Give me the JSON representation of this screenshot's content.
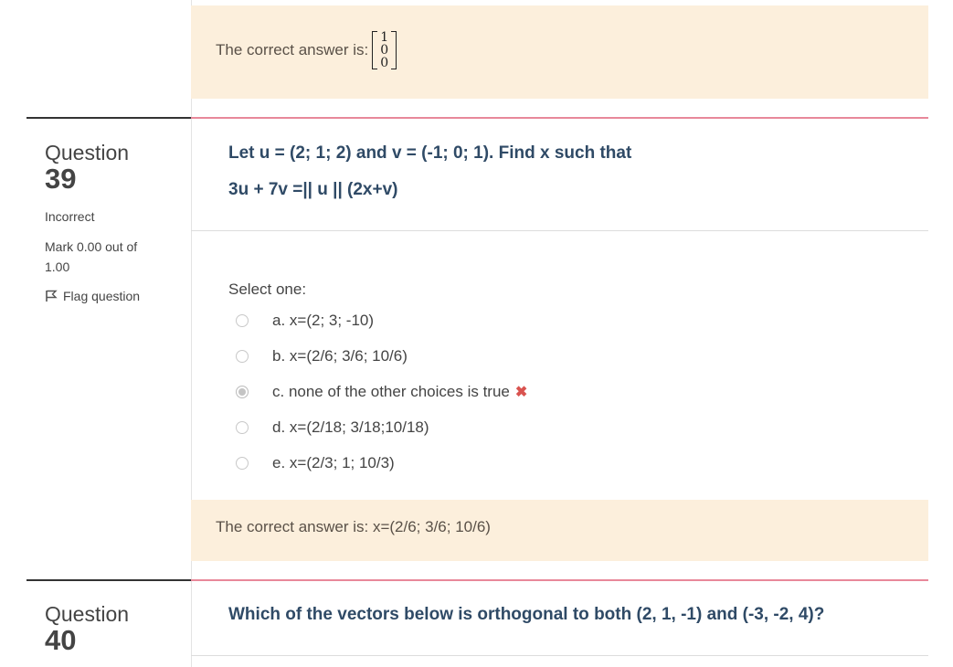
{
  "q38_feedback": {
    "label": "The correct answer is:",
    "matrix": [
      "1",
      "0",
      "0"
    ]
  },
  "q39": {
    "word": "Question",
    "number": "39",
    "state": "Incorrect",
    "mark_line1": "Mark 0.00 out of",
    "mark_line2": "1.00",
    "flag_label": "Flag question",
    "text_line1": "Let u = (2; 1; 2) and v = (-1; 0; 1). Find x such that",
    "text_line2": "3u + 7v =|| u || (2x+v)",
    "select_label": "Select one:",
    "options": [
      {
        "label": "a. x=(2; 3; -10)",
        "checked": false
      },
      {
        "label": "b. x=(2/6; 3/6; 10/6)",
        "checked": false
      },
      {
        "label": "c. none of the other choices is true",
        "checked": true
      },
      {
        "label": "d. x=(2/18; 3/18;10/18)",
        "checked": false
      },
      {
        "label": "e. x=(2/3; 1; 10/3)",
        "checked": false
      }
    ],
    "wrong_mark": "✖",
    "feedback": "The correct answer is: x=(2/6; 3/6; 10/6)"
  },
  "q40": {
    "word": "Question",
    "number": "40",
    "text": "Which of the vectors below is orthogonal to both (2, 1, -1) and (-3, -2, 4)?"
  },
  "colors": {
    "feedback_bg": "#fcefdc",
    "question_text": "#2f4a66",
    "pink_rule": "#e8889a",
    "wrong": "#d9534f"
  }
}
